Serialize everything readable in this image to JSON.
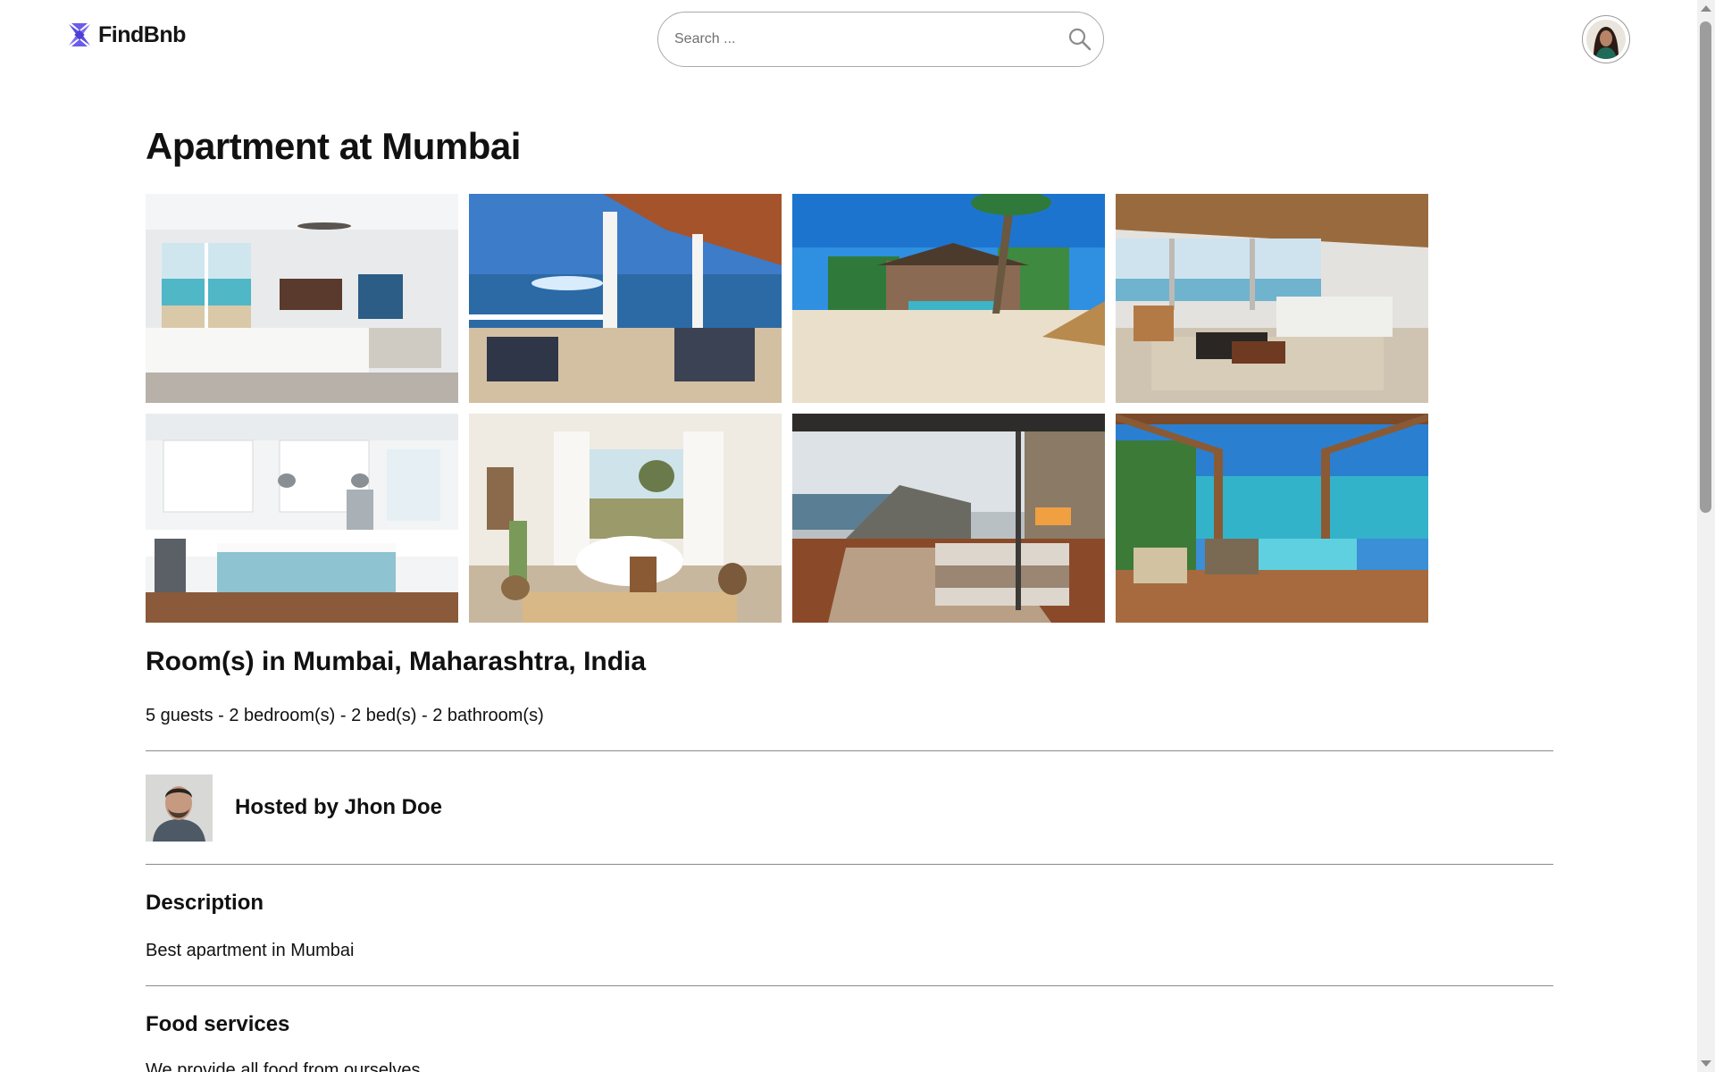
{
  "header": {
    "brand": "FindBnb",
    "logo_icon": "pinwheel-logo-icon",
    "search_placeholder": "Search ...",
    "search_icon": "search-icon",
    "avatar_icon": "user-avatar"
  },
  "colors": {
    "brand_purple": "#6c5ce7",
    "text": "#111111",
    "divider": "#8a8a8a"
  },
  "listing": {
    "title": "Apartment at Mumbai",
    "photos": [
      "bedroom with ocean view",
      "porch over the sea",
      "beach villa with palms",
      "open living room by the sea",
      "white kitchen with blue island",
      "bathroom with freestanding tub",
      "bedroom with glass wall over rocky coast",
      "pergola deck with pool"
    ],
    "location": "Room(s) in Mumbai, Maharashtra, India",
    "summary": "5 guests - 2 bedroom(s) - 2 bed(s) - 2 bathroom(s)",
    "host": "Hosted by Jhon Doe",
    "description_heading": "Description",
    "description_text": "Best apartment in Mumbai",
    "food_heading": "Food services",
    "food_text": "We provide all food from ourselves"
  }
}
